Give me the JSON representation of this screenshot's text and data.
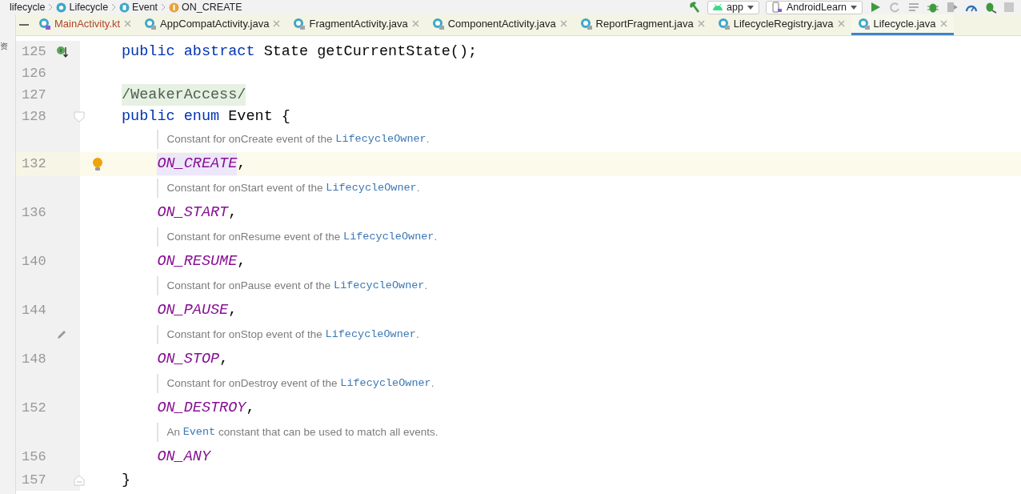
{
  "breadcrumb": [
    {
      "label": "lifecycle",
      "kind": "folder"
    },
    {
      "label": "Lifecycle",
      "kind": "class"
    },
    {
      "label": "Event",
      "kind": "enum"
    },
    {
      "label": "ON_CREATE",
      "kind": "field"
    }
  ],
  "run_configs": [
    {
      "label": "app",
      "kind": "module"
    },
    {
      "label": "AndroidLearn",
      "kind": "device"
    }
  ],
  "sidebar": {
    "label": "资"
  },
  "tabs": [
    {
      "label": "MainActivity.kt",
      "kind": "kotlin",
      "has_errors": true,
      "selected": false
    },
    {
      "label": "AppCompatActivity.java",
      "kind": "java",
      "has_errors": false,
      "selected": false
    },
    {
      "label": "FragmentActivity.java",
      "kind": "java",
      "has_errors": false,
      "selected": false
    },
    {
      "label": "ComponentActivity.java",
      "kind": "java",
      "has_errors": false,
      "selected": false
    },
    {
      "label": "ReportFragment.java",
      "kind": "java",
      "has_errors": false,
      "selected": false
    },
    {
      "label": "LifecycleRegistry.java",
      "kind": "java",
      "has_errors": false,
      "selected": false
    },
    {
      "label": "Lifecycle.java",
      "kind": "java",
      "has_errors": false,
      "selected": true
    }
  ],
  "lines": [
    {
      "number": "125",
      "current": false,
      "implemented": true,
      "fold_start": false,
      "fold_end": false,
      "tokens": [
        {
          "text": "public ",
          "kind": "keyword"
        },
        {
          "text": "abstract",
          "kind": "keyword"
        },
        {
          "text": " State getCurrentState();",
          "kind": "plain"
        }
      ]
    },
    {
      "number": "126",
      "current": false,
      "implemented": false,
      "fold_start": false,
      "fold_end": false
    },
    {
      "number": "127",
      "current": false,
      "implemented": false,
      "fold_start": false,
      "fold_end": false,
      "tokens": [
        {
          "text": "/WeakerAccess/",
          "kind": "annotation"
        }
      ]
    },
    {
      "number": "128",
      "current": false,
      "implemented": false,
      "fold_start": true,
      "fold_end": false,
      "tokens": [
        {
          "text": "public ",
          "kind": "keyword"
        },
        {
          "text": "enum",
          "kind": "keyword"
        },
        {
          "text": " Event {",
          "kind": "plain"
        }
      ],
      "children": [
        {
          "number": "132",
          "current": true,
          "bulb": true,
          "edited": false,
          "doc": [
            {
              "text": "Constant for onCreate event of the ",
              "kind": "prose"
            },
            {
              "text": "LifecycleOwner",
              "kind": "ref"
            },
            {
              "text": ".",
              "kind": "prose"
            }
          ],
          "tokens": [
            {
              "text": "ON_CREATE",
              "kind": "constant",
              "highlighted": true
            },
            {
              "text": ",",
              "kind": "plain",
              "highlighted": false
            }
          ]
        },
        {
          "number": "136",
          "current": false,
          "bulb": false,
          "edited": false,
          "doc": [
            {
              "text": "Constant for onStart event of the ",
              "kind": "prose"
            },
            {
              "text": "LifecycleOwner",
              "kind": "ref"
            },
            {
              "text": ".",
              "kind": "prose"
            }
          ],
          "tokens": [
            {
              "text": "ON_START",
              "kind": "constant",
              "highlighted": false
            },
            {
              "text": ",",
              "kind": "plain",
              "highlighted": false
            }
          ]
        },
        {
          "number": "140",
          "current": false,
          "bulb": false,
          "edited": false,
          "doc": [
            {
              "text": "Constant for onResume event of the ",
              "kind": "prose"
            },
            {
              "text": "LifecycleOwner",
              "kind": "ref"
            },
            {
              "text": ".",
              "kind": "prose"
            }
          ],
          "tokens": [
            {
              "text": "ON_RESUME",
              "kind": "constant",
              "highlighted": false
            },
            {
              "text": ",",
              "kind": "plain",
              "highlighted": false
            }
          ]
        },
        {
          "number": "144",
          "current": false,
          "bulb": false,
          "edited": false,
          "doc": [
            {
              "text": "Constant for onPause event of the ",
              "kind": "prose"
            },
            {
              "text": "LifecycleOwner",
              "kind": "ref"
            },
            {
              "text": ".",
              "kind": "prose"
            }
          ],
          "tokens": [
            {
              "text": "ON_PAUSE",
              "kind": "constant",
              "highlighted": false
            },
            {
              "text": ",",
              "kind": "plain",
              "highlighted": false
            }
          ]
        },
        {
          "number": "148",
          "current": false,
          "bulb": false,
          "edited": true,
          "doc": [
            {
              "text": "Constant for onStop event of the ",
              "kind": "prose"
            },
            {
              "text": "LifecycleOwner",
              "kind": "ref"
            },
            {
              "text": ".",
              "kind": "prose"
            }
          ],
          "tokens": [
            {
              "text": "ON_STOP",
              "kind": "constant",
              "highlighted": false
            },
            {
              "text": ",",
              "kind": "plain",
              "highlighted": false
            }
          ]
        },
        {
          "number": "152",
          "current": false,
          "bulb": false,
          "edited": false,
          "doc": [
            {
              "text": "Constant for onDestroy event of the ",
              "kind": "prose"
            },
            {
              "text": "LifecycleOwner",
              "kind": "ref"
            },
            {
              "text": ".",
              "kind": "prose"
            }
          ],
          "tokens": [
            {
              "text": "ON_DESTROY",
              "kind": "constant",
              "highlighted": false
            },
            {
              "text": ",",
              "kind": "plain",
              "highlighted": false
            }
          ]
        },
        {
          "number": "156",
          "current": false,
          "bulb": false,
          "edited": false,
          "doc": [
            {
              "text": "An ",
              "kind": "prose"
            },
            {
              "text": "Event",
              "kind": "ref"
            },
            {
              "text": " constant that can be used to match all events.",
              "kind": "prose"
            }
          ],
          "tokens": [
            {
              "text": "ON_ANY",
              "kind": "constant",
              "highlighted": false
            }
          ]
        }
      ]
    },
    {
      "number": "157",
      "current": false,
      "implemented": false,
      "fold_start": false,
      "fold_end": true,
      "tokens": [
        {
          "text": "}",
          "kind": "plain"
        }
      ]
    }
  ]
}
